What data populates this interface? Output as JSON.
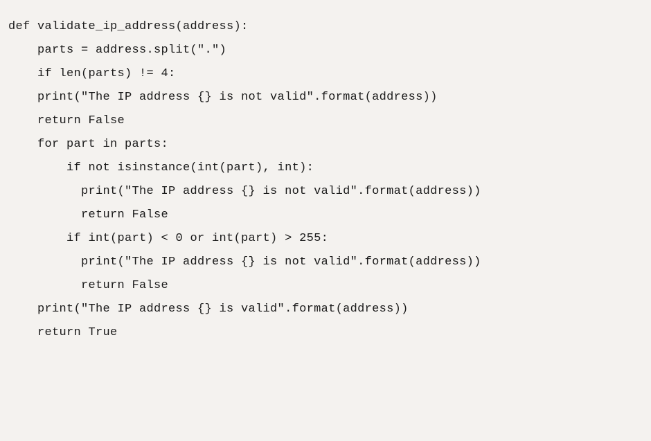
{
  "code": {
    "lines": [
      "def validate_ip_address(address):",
      "    parts = address.split(\".\")",
      "",
      "    if len(parts) != 4:",
      "    print(\"The IP address {} is not valid\".format(address))",
      "    return False",
      "",
      "    for part in parts:",
      "        if not isinstance(int(part), int):",
      "          print(\"The IP address {} is not valid\".format(address))",
      "          return False",
      "",
      "        if int(part) < 0 or int(part) > 255:",
      "          print(\"The IP address {} is not valid\".format(address))",
      "          return False",
      "",
      "    print(\"The IP address {} is valid\".format(address))",
      "    return True"
    ]
  }
}
